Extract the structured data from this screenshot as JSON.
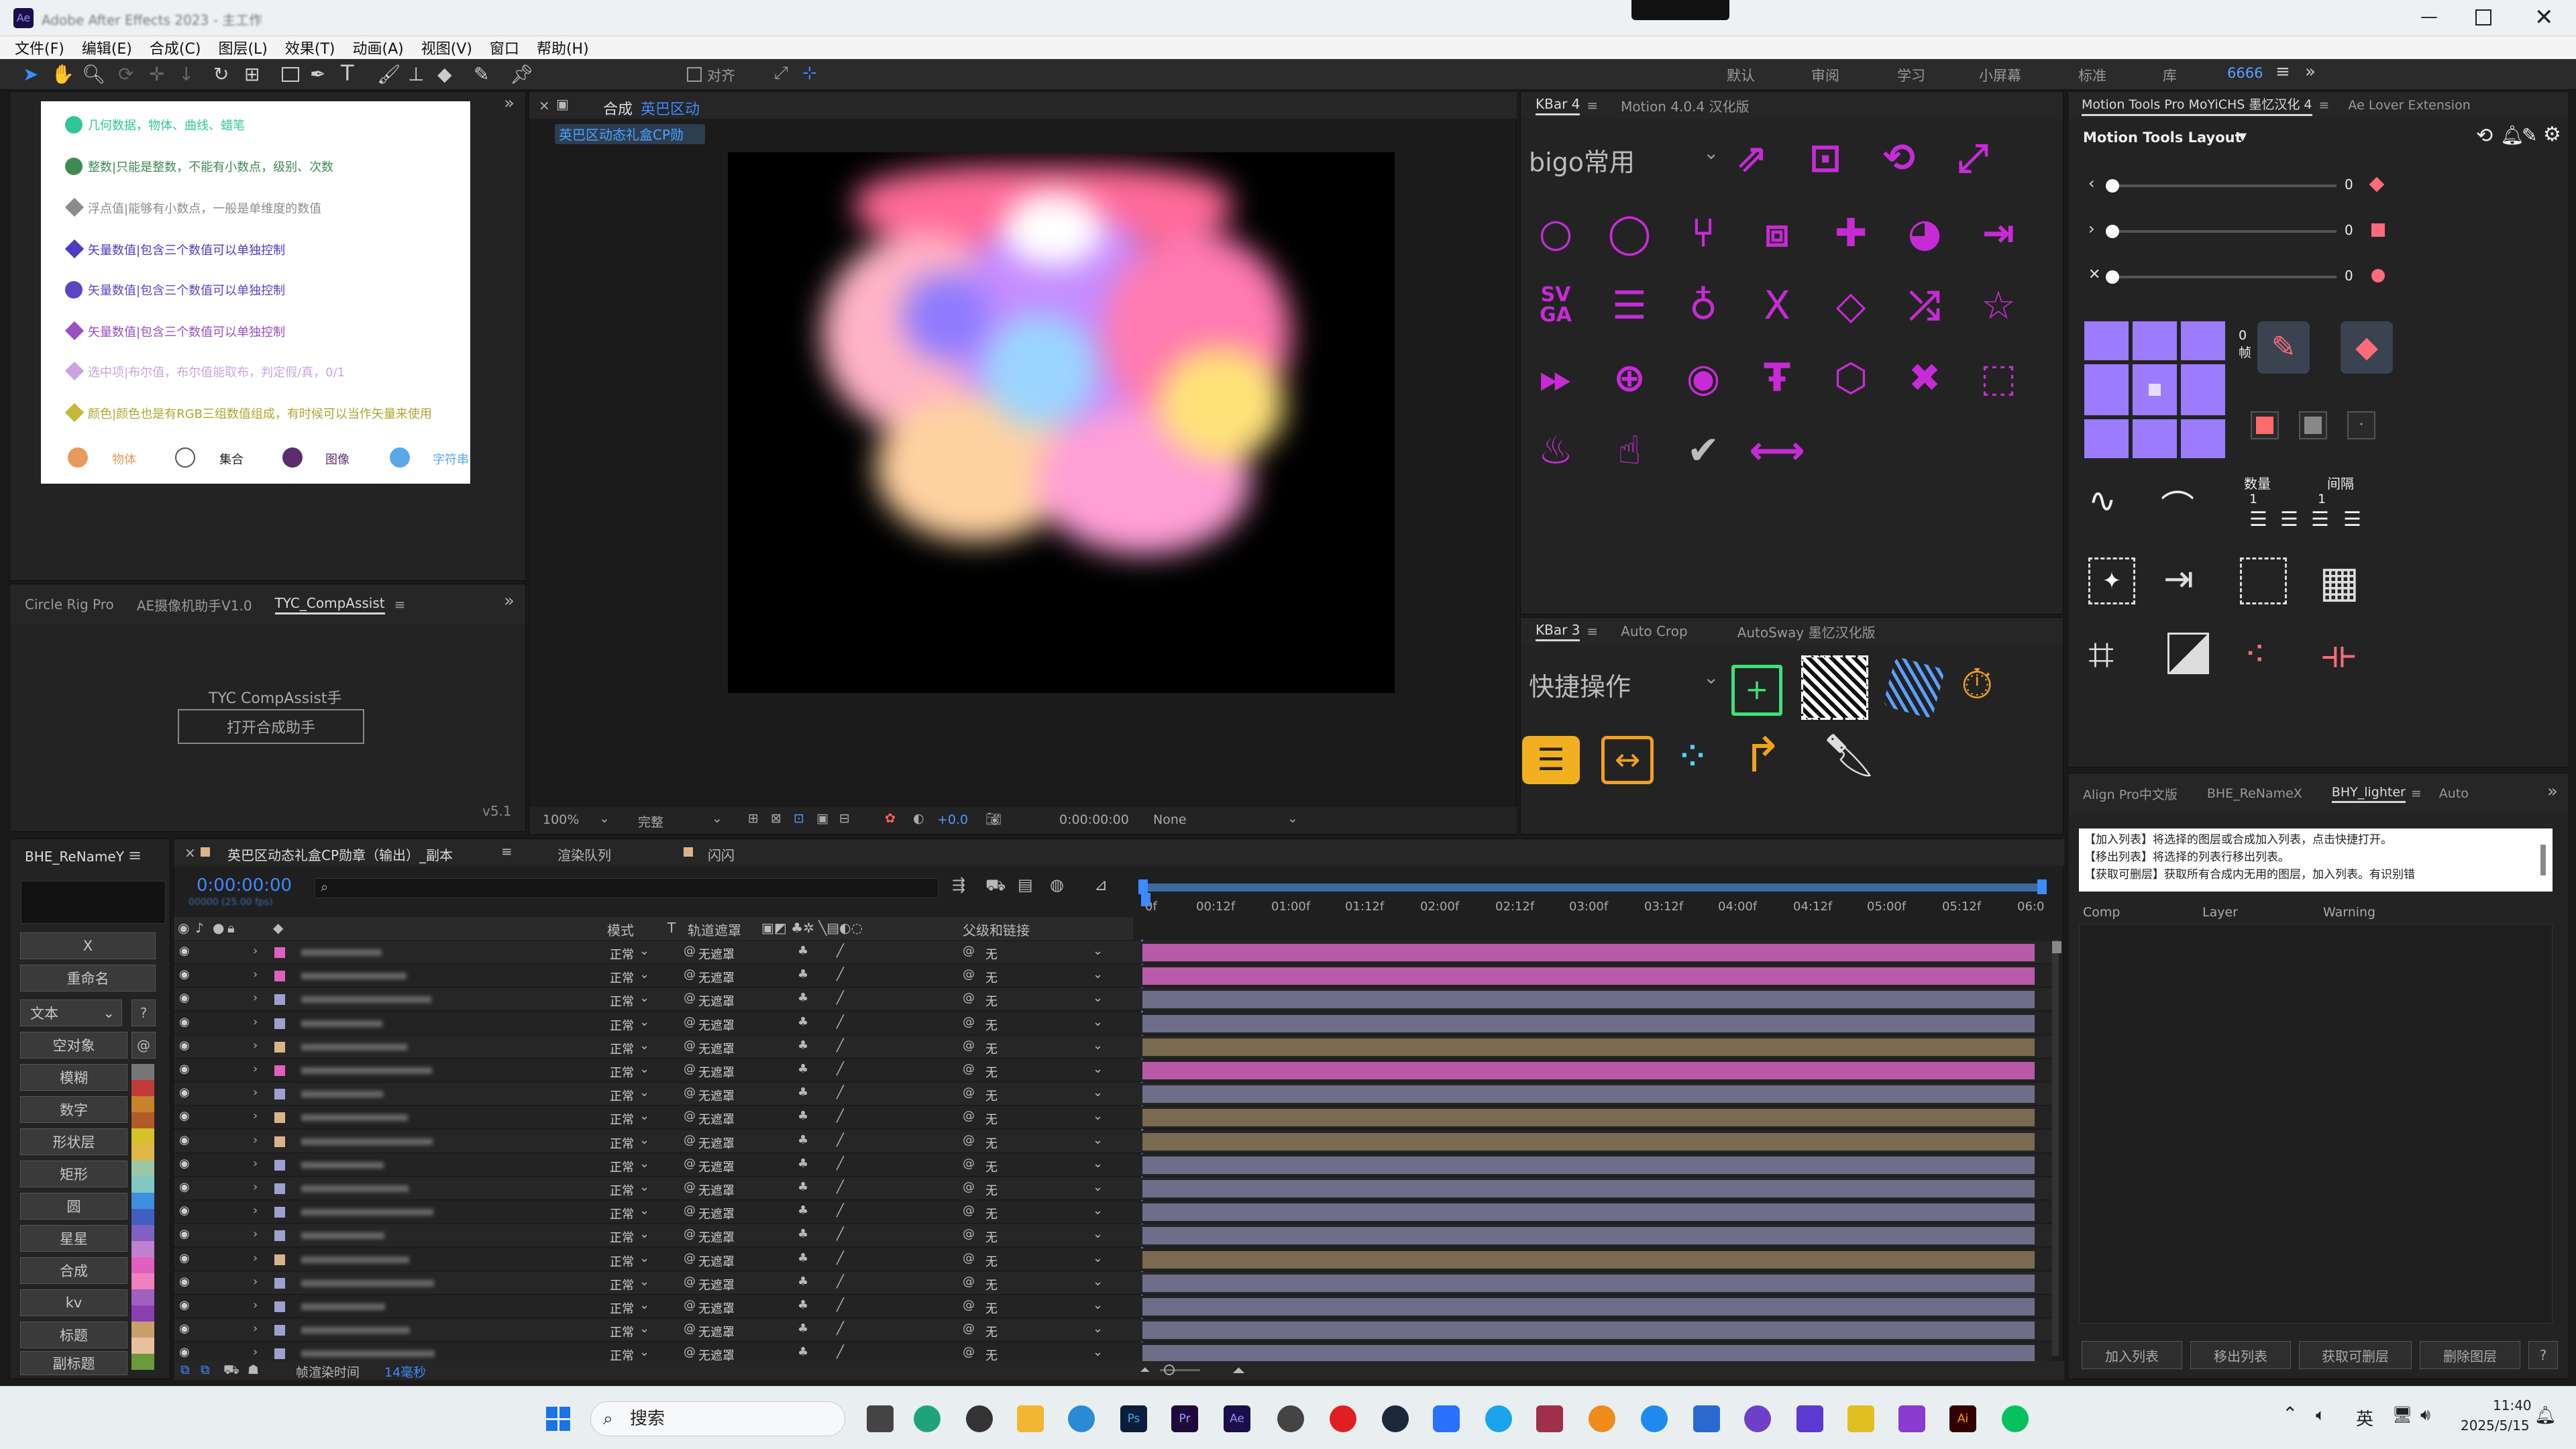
{
  "window": {
    "title": "Adobe After Effects 2023 - 主工作",
    "clock_time": "11:40",
    "clock_date": "2025/5/15"
  },
  "menu": [
    "文件(F)",
    "编辑(E)",
    "合成(C)",
    "图层(L)",
    "效果(T)",
    "动画(A)",
    "视图(V)",
    "窗口",
    "帮助(H)"
  ],
  "workspaces": [
    "默认",
    "审阅",
    "学习",
    "小屏幕",
    "标准",
    "库",
    "6666"
  ],
  "toolbar": {
    "align_label": "对齐"
  },
  "legend": {
    "items": [
      {
        "label": "几何数据，物体、曲线、蜡笔",
        "color": "#2ec79a"
      },
      {
        "label": "整数|只能是整数，不能有小数点，级别、次数",
        "color": "#3f8a52"
      },
      {
        "label": "浮点值|能够有小数点，一般是单维度的数值",
        "color": "#8c8c8c"
      },
      {
        "label": "矢量数值|包含三个数值可以单独控制",
        "color": "#4d3bc4"
      },
      {
        "label": "矢量数值|包含三个数值可以单独控制",
        "color": "#5946c4"
      },
      {
        "label": "矢量数值|包含三个数值可以单独控制",
        "color": "#9a4fc4"
      },
      {
        "label": "选中项|布尔值，布尔值能取布，判定假/真，0/1",
        "color": "#c9a4e0"
      },
      {
        "label": "颜色|颜色也是有RGB三组数值组成，有时候可以当作矢量来使用",
        "color": "#c4b83a"
      }
    ],
    "bottom": [
      {
        "label": "物体",
        "color": "#e89a5a"
      },
      {
        "label": "集合",
        "color": "#ffffff"
      },
      {
        "label": "图像",
        "color": "#5b2f6e"
      },
      {
        "label": "字符串",
        "color": "#5aa8e8"
      }
    ]
  },
  "left_panel": {
    "tabs": [
      "Circle Rig Pro",
      "AE摄像机助手V1.0",
      "TYC_CompAssist"
    ],
    "title": "TYC CompAssist手",
    "button": "打开合成助手",
    "version": "v5.1"
  },
  "comp_viewer": {
    "tab_title": "合成",
    "comp_name": "英巴区动",
    "breadcrumb": "英巴区动态礼盒CP勋",
    "zoom": "100%",
    "quality": "完整",
    "offset": "+0.0",
    "timecode": "0:00:00:00",
    "view": "None"
  },
  "kbar4": {
    "tabs": [
      "KBar 4",
      "Motion 4.0.4 汉化版"
    ],
    "group": "bigo常用",
    "svga": "SV GA"
  },
  "kbar3": {
    "tabs": [
      "KBar 3",
      "Auto Crop",
      "AutoSway 墨忆汉化版"
    ],
    "group": "快捷操作"
  },
  "motion_tools": {
    "tabs": [
      "Motion Tools Pro MoYiCHS 墨忆汉化 4",
      "Ae Lover Extension"
    ],
    "layout_label": "Motion Tools Layout",
    "slider_values": [
      "0",
      "0",
      "0"
    ],
    "frame_label": "0 帧",
    "qty_label": "数量",
    "gap_label": "间隔",
    "qty_value": "1",
    "gap_value": "1"
  },
  "bhy": {
    "tabs": [
      "Align Pro中文版",
      "BHE_ReNameX",
      "BHY_lighter",
      "Auto"
    ],
    "info_lines": [
      "【加入列表】将选择的图层或合成加入列表，点击快捷打开。",
      "【移出列表】将选择的列表行移出列表。",
      "【获取可删层】获取所有合成内无用的图层，加入列表。有识别错"
    ],
    "col_headers": [
      "Comp",
      "Layer",
      "Warning"
    ],
    "buttons": [
      "加入列表",
      "移出列表",
      "获取可删层",
      "删除图层",
      "?"
    ]
  },
  "bhe_panel": {
    "tab": "BHE_ReNameY",
    "buttons": [
      "X",
      "重命名",
      "文本",
      "空对象",
      "模糊",
      "数字",
      "形状层",
      "矩形",
      "圆",
      "星星",
      "合成",
      "kv",
      "标题",
      "副标题"
    ],
    "q": "?"
  },
  "timeline": {
    "tab": "英巴区动态礼盒CP勋章（输出）_副本",
    "tabs_extra": [
      "渲染队列",
      "闪闪"
    ],
    "timecode": "0:00:00:00",
    "frame_info": "00000 (25.00 fps)",
    "mode_header": "模式",
    "t_header": "T",
    "track_header": "轨道遮罩",
    "parent_header": "父级和链接",
    "mode_value": "正常",
    "track_value": "无遮罩",
    "parent_value": "无",
    "render_time_label": "帧渲染时间",
    "render_time_value": "14毫秒",
    "ruler": [
      "0f",
      "00:12f",
      "01:00f",
      "01:12f",
      "02:00f",
      "02:12f",
      "03:00f",
      "03:12f",
      "04:00f",
      "04:12f",
      "05:00f",
      "05:12f",
      "06:0"
    ]
  },
  "taskbar": {
    "search": "搜索",
    "ime": "英"
  }
}
